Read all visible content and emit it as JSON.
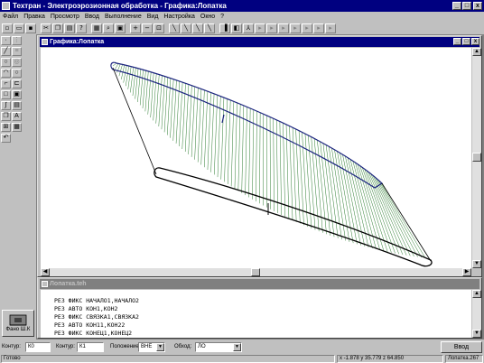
{
  "app": {
    "title": "Техтран - Электроэрозионная обработка - Графика:Лопатка",
    "buttons": [
      "_",
      "□",
      "x"
    ]
  },
  "menu": [
    "Файл",
    "Правка",
    "Просмотр",
    "Ввод",
    "Выполнение",
    "Вид",
    "Настройка",
    "Окно",
    "?"
  ],
  "graph_window": {
    "title": "Графика:Лопатка",
    "colors": {
      "hatch": "#2e7d32",
      "outline": "#1a237e",
      "dark": "#000000"
    }
  },
  "text_window": {
    "title": "Лопатка.teh",
    "lines": [
      "РЕЗ ФИКС НАЧАЛО1,НАЧАЛО2",
      "РЕЗ АВТО КОН1,КОН2",
      "РЕЗ ФИКС СВЯЗКА1,СВЯЗКА2",
      "РЕЗ АВТО КОН11,КОН22",
      "РЕЗ ФИКС КОНЕЦ1,КОНЕЦ2"
    ]
  },
  "fano": {
    "label": "Фано Ш.К"
  },
  "input_bar": {
    "contour1_label": "Контур:",
    "contour1_value": "К0",
    "contour2_label": "Контур:",
    "contour2_value": "К1",
    "position_label": "Положение:",
    "position_value": "ВНЕ",
    "bypass_label": "Обход:",
    "bypass_value": "ЛО",
    "enter_button": "Ввод"
  },
  "status": {
    "ready": "Готово",
    "coords": "x -1.878 y 35.779 z 64.850",
    "file": "Лопатка.267"
  }
}
